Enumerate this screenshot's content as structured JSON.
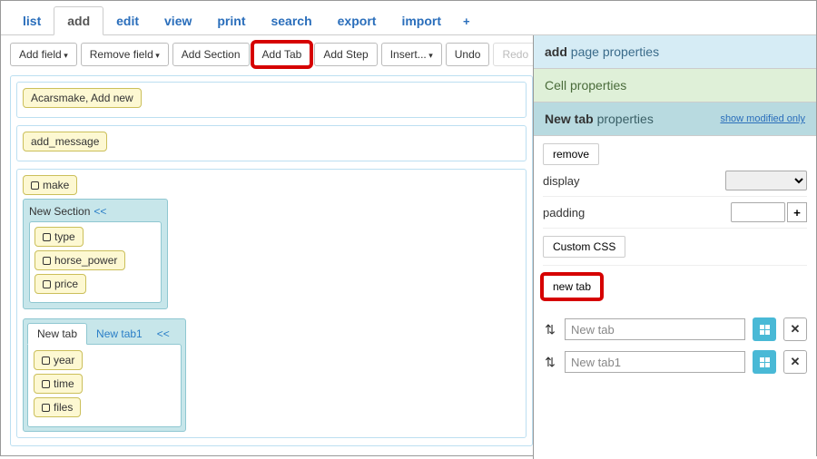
{
  "topTabs": {
    "list": "list",
    "add": "add",
    "edit": "edit",
    "view": "view",
    "print": "print",
    "search": "search",
    "export": "export",
    "import": "import"
  },
  "toolbar": {
    "addField": "Add field",
    "removeField": "Remove field",
    "addSection": "Add Section",
    "addTab": "Add Tab",
    "addStep": "Add Step",
    "insert": "Insert...",
    "undo": "Undo",
    "redo": "Redo"
  },
  "canvas": {
    "breadcrumb": "Acarsmake, Add new",
    "add_message": "add_message",
    "field_make": "make",
    "newSection": {
      "title": "New Section",
      "arrows": "<<",
      "fields": {
        "type": "type",
        "horse_power": "horse_power",
        "price": "price"
      }
    },
    "tabs": {
      "tab0": "New tab",
      "tab1": "New tab1",
      "arrows": "<<",
      "fields": {
        "year": "year",
        "time": "time",
        "files": "files"
      }
    }
  },
  "right": {
    "addPageProps": {
      "strong": "add",
      "rest": " page properties"
    },
    "cellProps": "Cell properties",
    "newTabProps": {
      "strong": "New tab",
      "rest": " properties"
    },
    "showModified": "show modified only",
    "removeBtn": "remove",
    "displayLabel": "display",
    "paddingLabel": "padding",
    "customCss": "Custom CSS",
    "newTabBtn": "new tab",
    "tabItems": {
      "t0": "New tab",
      "t1": "New tab1"
    }
  }
}
